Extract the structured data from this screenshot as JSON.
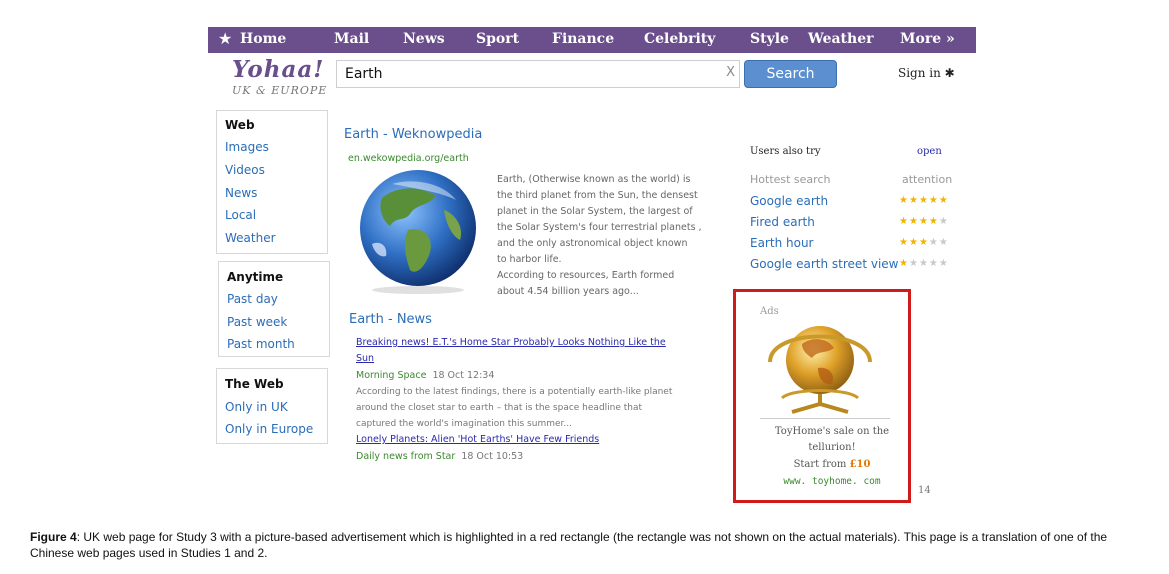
{
  "nav": {
    "star": "★",
    "items": [
      "Home",
      "Mail",
      "News",
      "Sport",
      "Finance",
      "Celebrity",
      "Style",
      "Weather",
      "More »"
    ]
  },
  "logo": {
    "name": "Yohaa!",
    "region": "UK & EUROPE"
  },
  "search": {
    "value": "Earth",
    "clear": "X",
    "button": "Search"
  },
  "signin": "Sign in ✱",
  "left": {
    "type_head": "Web",
    "types": [
      "Images",
      "Videos",
      "News",
      "Local",
      "Weather"
    ],
    "time_head": "Anytime",
    "times": [
      "Past day",
      "Past week",
      "Past month"
    ],
    "scope_head": "The Web",
    "scopes": [
      "Only in UK",
      "Only in Europe"
    ]
  },
  "result1": {
    "title": "Earth - Weknowpedia",
    "url": "en.wekowpedia.org/earth",
    "lines": [
      "Earth, (Otherwise known as the world) is",
      "the third planet from the Sun, the densest",
      "planet in the Solar System, the largest of",
      "the Solar System's four terrestrial planets ,",
      "and the only astronomical object known",
      "to harbor life.",
      "According to resources, Earth formed",
      "about 4.54 billion years ago..."
    ]
  },
  "news": {
    "title": "Earth - News",
    "item1_link_a": "Breaking news! E.T.'s Home Star Probably Looks Nothing Like the",
    "item1_link_b": "Sun",
    "item1_source": "Morning Space",
    "item1_date": "18  Oct  12:34",
    "item1_text": [
      "According to the latest findings, there is a potentially earth-like planet",
      "around the closet star to earth – that is the space headline that",
      "captured the world's imagination this  summer..."
    ],
    "item2_link": "Lonely Planets: Alien  'Hot Earths' Have Few Friends",
    "item2_source": "Daily news from Star",
    "item2_date": "18  Oct  10:53"
  },
  "related": {
    "head": "Users also try",
    "open": "open",
    "hot_head": "Hottest search",
    "attention": "attention",
    "items": [
      {
        "label": "Google earth",
        "stars": 5
      },
      {
        "label": "Fired earth",
        "stars": 4
      },
      {
        "label": "Earth hour",
        "stars": 3
      },
      {
        "label": "Google earth street view",
        "stars": 1
      }
    ]
  },
  "ad": {
    "label": "Ads",
    "line1": "ToyHome's sale on the",
    "line2": "tellurion!",
    "price_prefix": "Start from ",
    "price": "£10",
    "url": "www. toyhome. com"
  },
  "page_number": "14",
  "caption": {
    "label": "Figure 4",
    "text": ": UK web page for Study 3 with a picture-based advertisement which is highlighted in a red rectangle (the rectangle was not shown on the actual materials). This page is a translation of one of the Chinese web pages used in Studies 1 and 2."
  }
}
